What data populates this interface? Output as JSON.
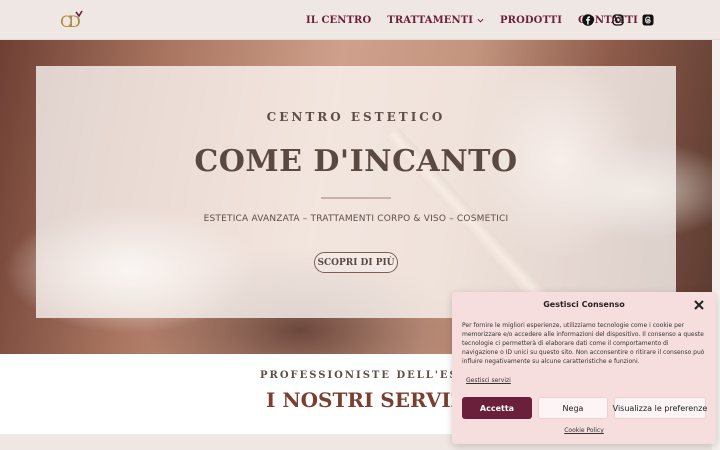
{
  "header": {
    "logo_alt": "CD",
    "nav": [
      {
        "label": "IL CENTRO"
      },
      {
        "label": "TRATTAMENTI"
      },
      {
        "label": "PRODOTTI"
      },
      {
        "label": "CONTATTI"
      }
    ],
    "social_icons": [
      "facebook-icon",
      "instagram-icon",
      "threads-icon"
    ],
    "accent_color": "#6a1f3a"
  },
  "hero": {
    "eyebrow": "CENTRO ESTETICO",
    "title": "COME D'INCANTO",
    "subtitle": "ESTETICA AVANZATA – TRATTAMENTI CORPO & VISO – COSMETICI",
    "button_label": "SCOPRI DI PIÙ"
  },
  "services": {
    "eyebrow": "PROFESSIONISTE DELL'ESTETICA",
    "title": "I NOSTRI SERVIZI"
  },
  "cookie": {
    "title": "Gestisci Consenso",
    "text": "Per fornire le migliori esperienze, utilizziamo tecnologie come i cookie per memorizzare e/o accedere alle informazioni del dispositivo. Il consenso a queste tecnologie ci permetterà di elaborare dati come il comportamento di navigazione o ID unici su questo sito. Non acconsentire o ritirare il consenso può influire negativamente su alcune caratteristiche e funzioni.",
    "services_link": "Gestisci servizi",
    "accept_label": "Accetta",
    "deny_label": "Nega",
    "prefs_label": "Visualizza le preferenze",
    "policy_link": "Cookie Policy"
  }
}
